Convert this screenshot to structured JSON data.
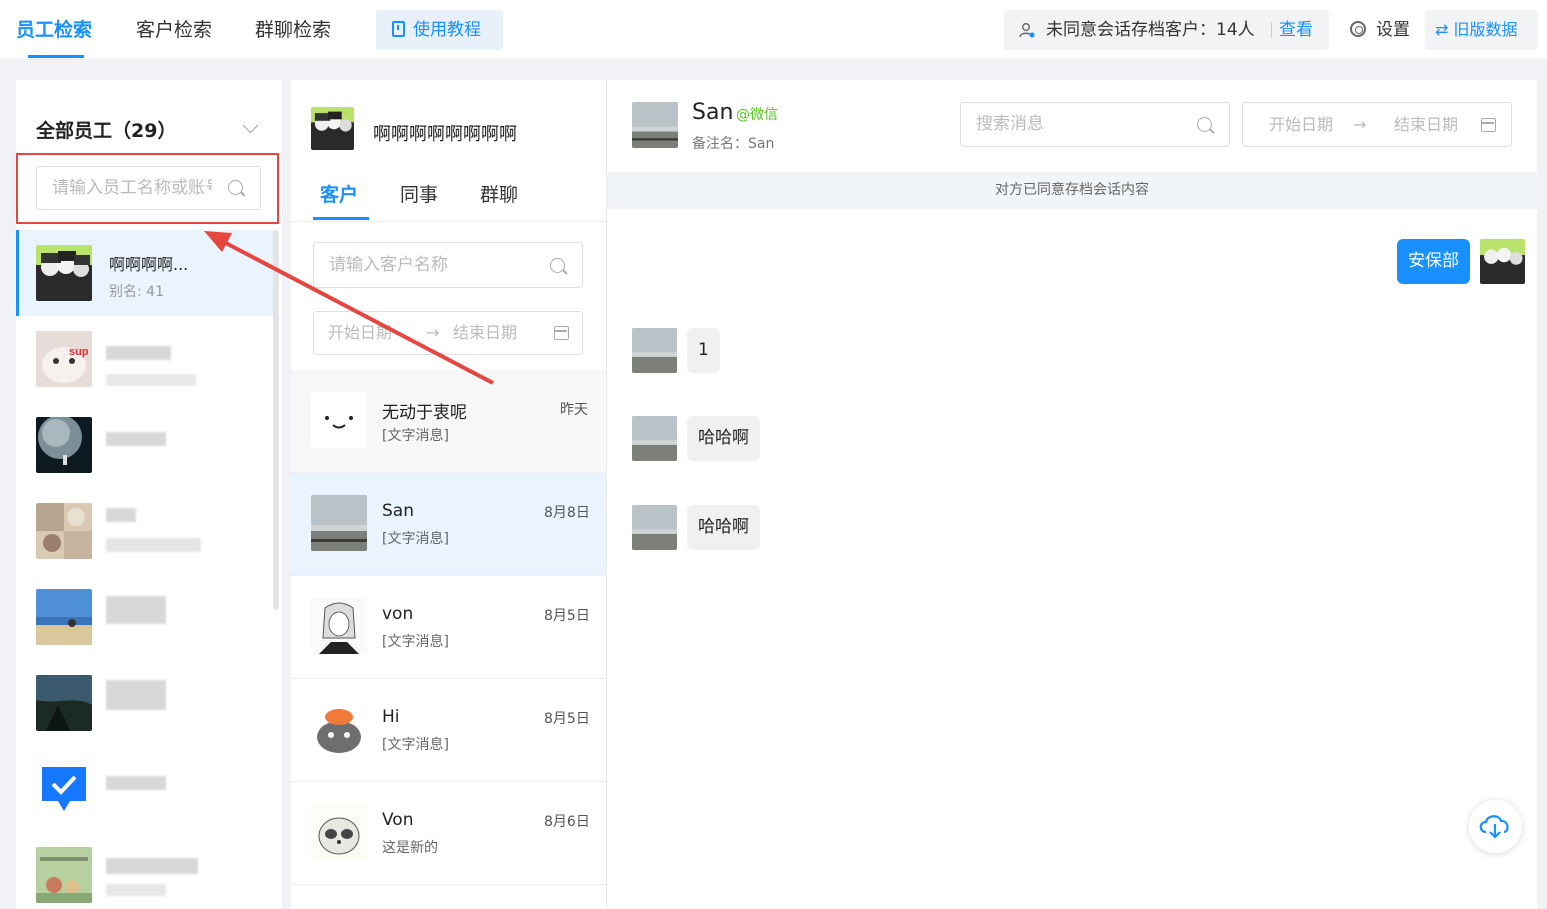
{
  "topbar": {
    "tabs": [
      {
        "label": "员工检索",
        "active": true
      },
      {
        "label": "客户检索",
        "active": false
      },
      {
        "label": "群聊检索",
        "active": false
      }
    ],
    "tutorial_label": "使用教程",
    "consent_text": "未同意会话存档客户：14人",
    "view_label": "查看",
    "settings_label": "设置",
    "old_data_label": "⇄ 旧版数据"
  },
  "employees": {
    "title": "全部员工（29）",
    "search_placeholder": "请输入员工名称或账号",
    "items": [
      {
        "name": "啊啊啊啊...",
        "alias": "别名: 41",
        "active": true
      },
      {
        "name": "",
        "alias": "",
        "blurred": true
      },
      {
        "name": "",
        "alias": "",
        "blurred": true
      },
      {
        "name": "",
        "alias": "",
        "blurred": true
      },
      {
        "name": "",
        "alias": "",
        "blurred": true
      },
      {
        "name": "",
        "alias": "",
        "blurred": true
      },
      {
        "name": "",
        "alias": "",
        "blurred": true
      },
      {
        "name": "",
        "alias": "",
        "blurred": true
      }
    ]
  },
  "customers": {
    "employee_name": "啊啊啊啊啊啊啊啊",
    "tabs": [
      {
        "label": "客户",
        "active": true
      },
      {
        "label": "同事",
        "active": false
      },
      {
        "label": "群聊",
        "active": false
      }
    ],
    "search_placeholder": "请输入客户名称",
    "start_date_placeholder": "开始日期",
    "end_date_placeholder": "结束日期",
    "date_arrow": "→",
    "conversations": [
      {
        "name": "无动于衷呢",
        "message": "[文字消息]",
        "date": "昨天"
      },
      {
        "name": "San",
        "message": "[文字消息]",
        "date": "8月8日",
        "active": true
      },
      {
        "name": "von",
        "message": "[文字消息]",
        "date": "8月5日"
      },
      {
        "name": "Hi",
        "message": "[文字消息]",
        "date": "8月5日"
      },
      {
        "name": "Von",
        "message": "这是新的",
        "date": "8月6日"
      }
    ]
  },
  "chat": {
    "contact_name": "San",
    "contact_source": "@微信",
    "remark": "备注名：San",
    "search_placeholder": "搜索消息",
    "start_date_placeholder": "开始日期",
    "end_date_placeholder": "结束日期",
    "date_arrow": "→",
    "consent_notice": "对方已同意存档会话内容",
    "messages": [
      {
        "text": "安保部",
        "from": "employee"
      },
      {
        "text": "1",
        "from": "customer"
      },
      {
        "text": "哈哈啊",
        "from": "customer"
      },
      {
        "text": "哈哈啊",
        "from": "customer"
      }
    ]
  },
  "colors": {
    "accent": "#1890ff",
    "highlight_red": "#e5463f",
    "wechat_green": "#52c41a"
  }
}
